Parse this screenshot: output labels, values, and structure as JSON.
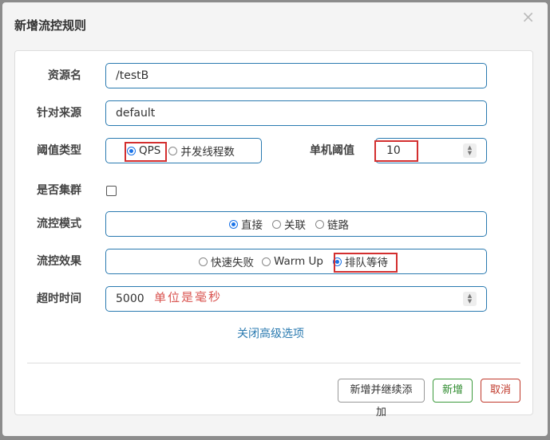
{
  "dialog": {
    "title": "新增流控规则",
    "close_label": "×"
  },
  "form": {
    "resource": {
      "label": "资源名",
      "value": "/testB"
    },
    "source": {
      "label": "针对来源",
      "value": "default"
    },
    "threshold_type": {
      "label": "阈值类型",
      "options": [
        {
          "label": "QPS",
          "selected": true
        },
        {
          "label": "并发线程数",
          "selected": false
        }
      ]
    },
    "single_threshold": {
      "label": "单机阈值",
      "value": "10"
    },
    "cluster": {
      "label": "是否集群",
      "checked": false
    },
    "flow_mode": {
      "label": "流控模式",
      "options": [
        {
          "label": "直接",
          "selected": true
        },
        {
          "label": "关联",
          "selected": false
        },
        {
          "label": "链路",
          "selected": false
        }
      ]
    },
    "flow_effect": {
      "label": "流控效果",
      "options": [
        {
          "label": "快速失败",
          "selected": false
        },
        {
          "label": "Warm Up",
          "selected": false
        },
        {
          "label": "排队等待",
          "selected": true
        }
      ]
    },
    "timeout": {
      "label": "超时时间",
      "value": "5000",
      "annotation": "单位是毫秒"
    },
    "advanced_toggle": "关闭高级选项"
  },
  "footer": {
    "add_continue": "新增并继续添加",
    "add": "新增",
    "cancel": "取消"
  },
  "colors": {
    "accent": "#1a73e8",
    "field_border": "#2a7ab0",
    "highlight_red": "#d32f2f",
    "success": "#2e8b2e",
    "danger": "#c0392b"
  }
}
